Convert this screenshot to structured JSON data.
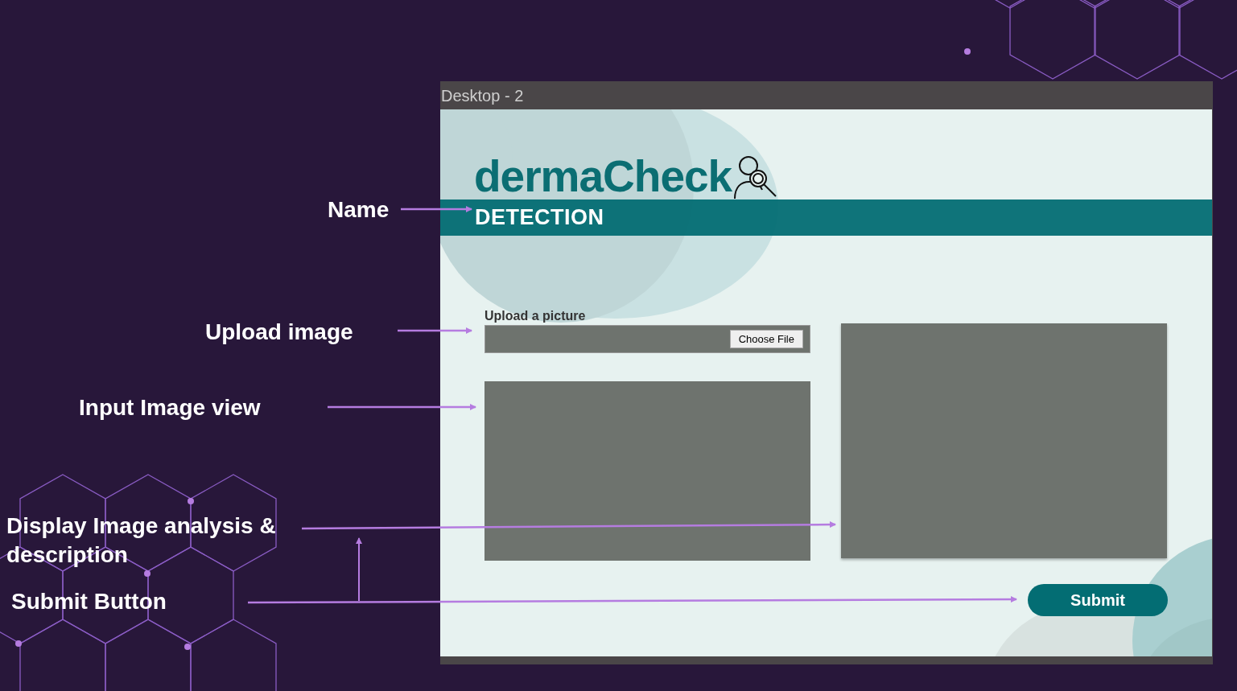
{
  "annotations": [
    {
      "text": "Name"
    },
    {
      "text": "Upload image"
    },
    {
      "text": "Input Image view"
    },
    {
      "text": "Display Image analysis & description"
    },
    {
      "text": "Submit Button"
    }
  ],
  "mockup": {
    "title": "Desktop - 2",
    "logo": "dermaCheck",
    "banner": "DETECTION",
    "upload_label": "Upload a picture",
    "choose_file": "Choose File",
    "submit": "Submit"
  }
}
